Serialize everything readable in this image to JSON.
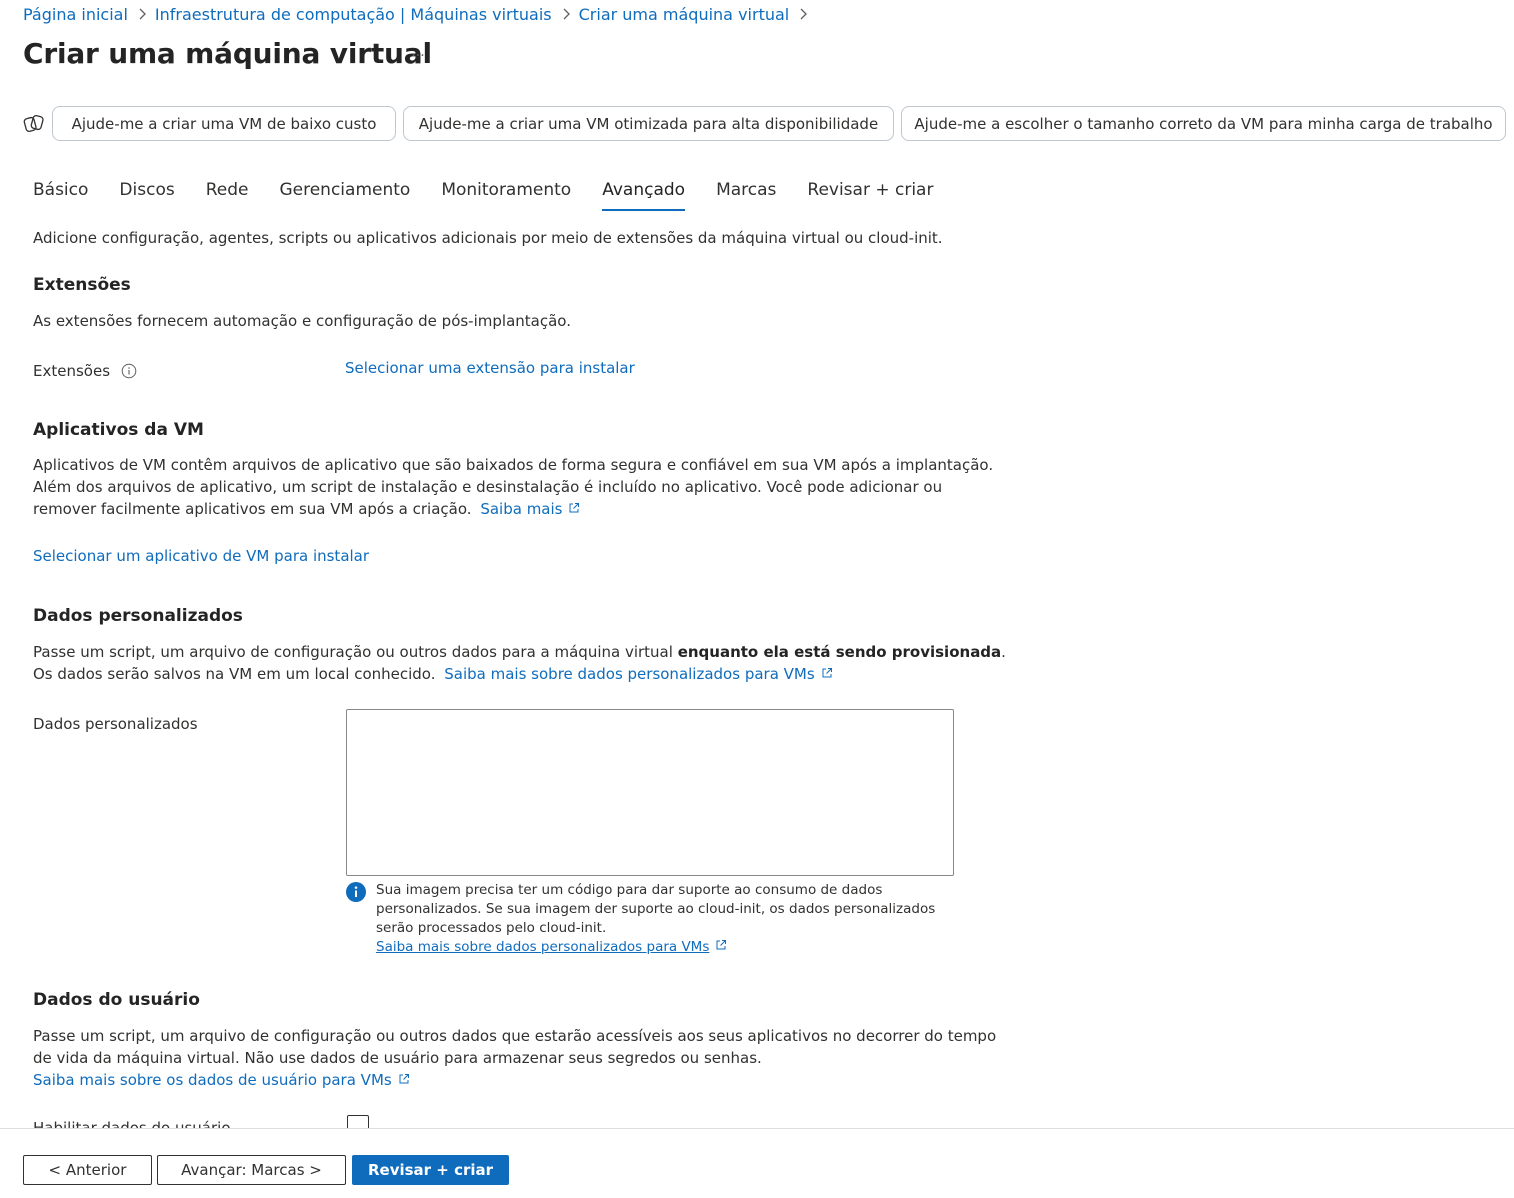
{
  "breadcrumb": {
    "items": [
      "Página inicial",
      "Infraestrutura de computação | Máquinas virtuais",
      "Criar uma máquina virtual"
    ]
  },
  "page": {
    "title": "Criar uma máquina virtual",
    "more_label": "···"
  },
  "copilot_prompts": [
    "Ajude-me a criar uma VM de baixo custo",
    "Ajude-me a criar uma VM otimizada para alta disponibilidade",
    "Ajude-me a escolher o tamanho correto da VM para minha carga de trabalho"
  ],
  "tabs": [
    {
      "label": "Básico",
      "active": false
    },
    {
      "label": "Discos",
      "active": false
    },
    {
      "label": "Rede",
      "active": false
    },
    {
      "label": "Gerenciamento",
      "active": false
    },
    {
      "label": "Monitoramento",
      "active": false
    },
    {
      "label": "Avançado",
      "active": true
    },
    {
      "label": "Marcas",
      "active": false
    },
    {
      "label": "Revisar + criar",
      "active": false
    }
  ],
  "intro": "Adicione configuração, agentes, scripts ou aplicativos adicionais por meio de extensões da máquina virtual ou cloud-init.",
  "extensions": {
    "title": "Extensões",
    "description": "As extensões fornecem automação e configuração de pós-implantação.",
    "field_label": "Extensões",
    "select_link": "Selecionar uma extensão para instalar"
  },
  "vm_apps": {
    "title": "Aplicativos da VM",
    "line1": "Aplicativos de VM contêm arquivos de aplicativo que são baixados de forma segura e confiável em sua VM após a implantação.",
    "line2": "Além dos arquivos de aplicativo, um script de instalação e desinstalação é incluído no aplicativo. Você pode adicionar ou",
    "line3": "remover facilmente aplicativos em sua VM após a criação.",
    "learn_more": "Saiba mais",
    "select_link": "Selecionar um aplicativo de VM para instalar"
  },
  "custom_data": {
    "title": "Dados personalizados",
    "line1_start": "Passe um script, um arquivo de configuração ou outros dados para a máquina virtual ",
    "line1_bold": "enquanto ela está sendo provisionada",
    "line1_end": ".",
    "line2": "Os dados serão salvos na VM em um local conhecido.",
    "learn_more": "Saiba mais sobre dados personalizados para VMs",
    "field_label": "Dados personalizados",
    "value": "",
    "info_text": "Sua imagem precisa ter um código para dar suporte ao consumo de dados personalizados. Se sua imagem der suporte ao cloud-init, os dados personalizados serão processados pelo cloud-init.",
    "info_link": "Saiba mais sobre dados personalizados para VMs"
  },
  "user_data": {
    "title": "Dados do usuário",
    "line1": "Passe um script, um arquivo de configuração ou outros dados que estarão acessíveis aos seus aplicativos no decorrer do tempo",
    "line2": "de vida da máquina virtual. Não use dados de usuário para armazenar seus segredos ou senhas.",
    "learn_more": "Saiba mais sobre os dados de usuário para VMs",
    "enable_label": "Habilitar dados do usuário",
    "enabled": false
  },
  "footer": {
    "previous": "< Anterior",
    "next": "Avançar: Marcas >",
    "review": "Revisar + criar"
  },
  "colors": {
    "accent": "#0f6cbd",
    "text": "#323130"
  }
}
